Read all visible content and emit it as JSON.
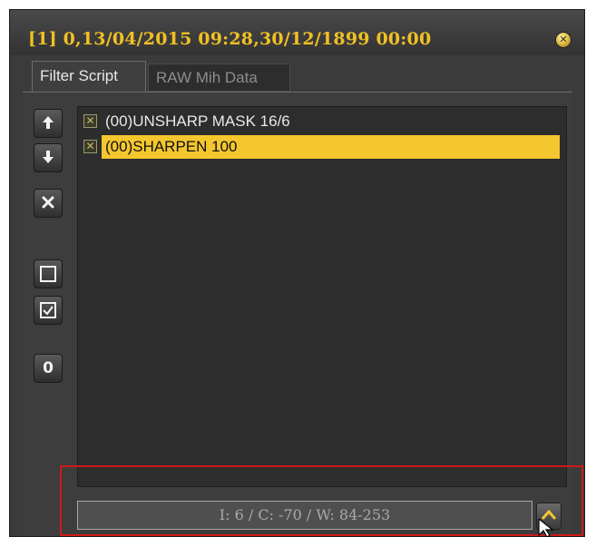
{
  "window": {
    "title": "[1] 0,13/04/2015 09:28,30/12/1899 00:00",
    "close_icon": "close-icon"
  },
  "tabs": [
    {
      "label": "Filter Script",
      "active": true
    },
    {
      "label": "RAW Mih Data",
      "active": false
    }
  ],
  "toolbar": {
    "buttons": [
      {
        "icon": "arrow-up-icon"
      },
      {
        "icon": "arrow-down-icon"
      },
      {
        "icon": "delete-icon"
      },
      {
        "icon": "uncheck-all-icon"
      },
      {
        "icon": "check-all-icon"
      },
      {
        "icon": "reset-zero-icon",
        "glyph": "0"
      }
    ]
  },
  "filters": [
    {
      "label": "(00)UNSHARP MASK 16/6",
      "checked": true,
      "selected": false
    },
    {
      "label": "(00)SHARPEN 100",
      "checked": true,
      "selected": true
    }
  ],
  "status": {
    "text": "I: 6 / C: -70 / W: 84-253"
  },
  "colors": {
    "title": "#f1c024",
    "selection": "#f4c72e",
    "annotation": "#d01818"
  }
}
